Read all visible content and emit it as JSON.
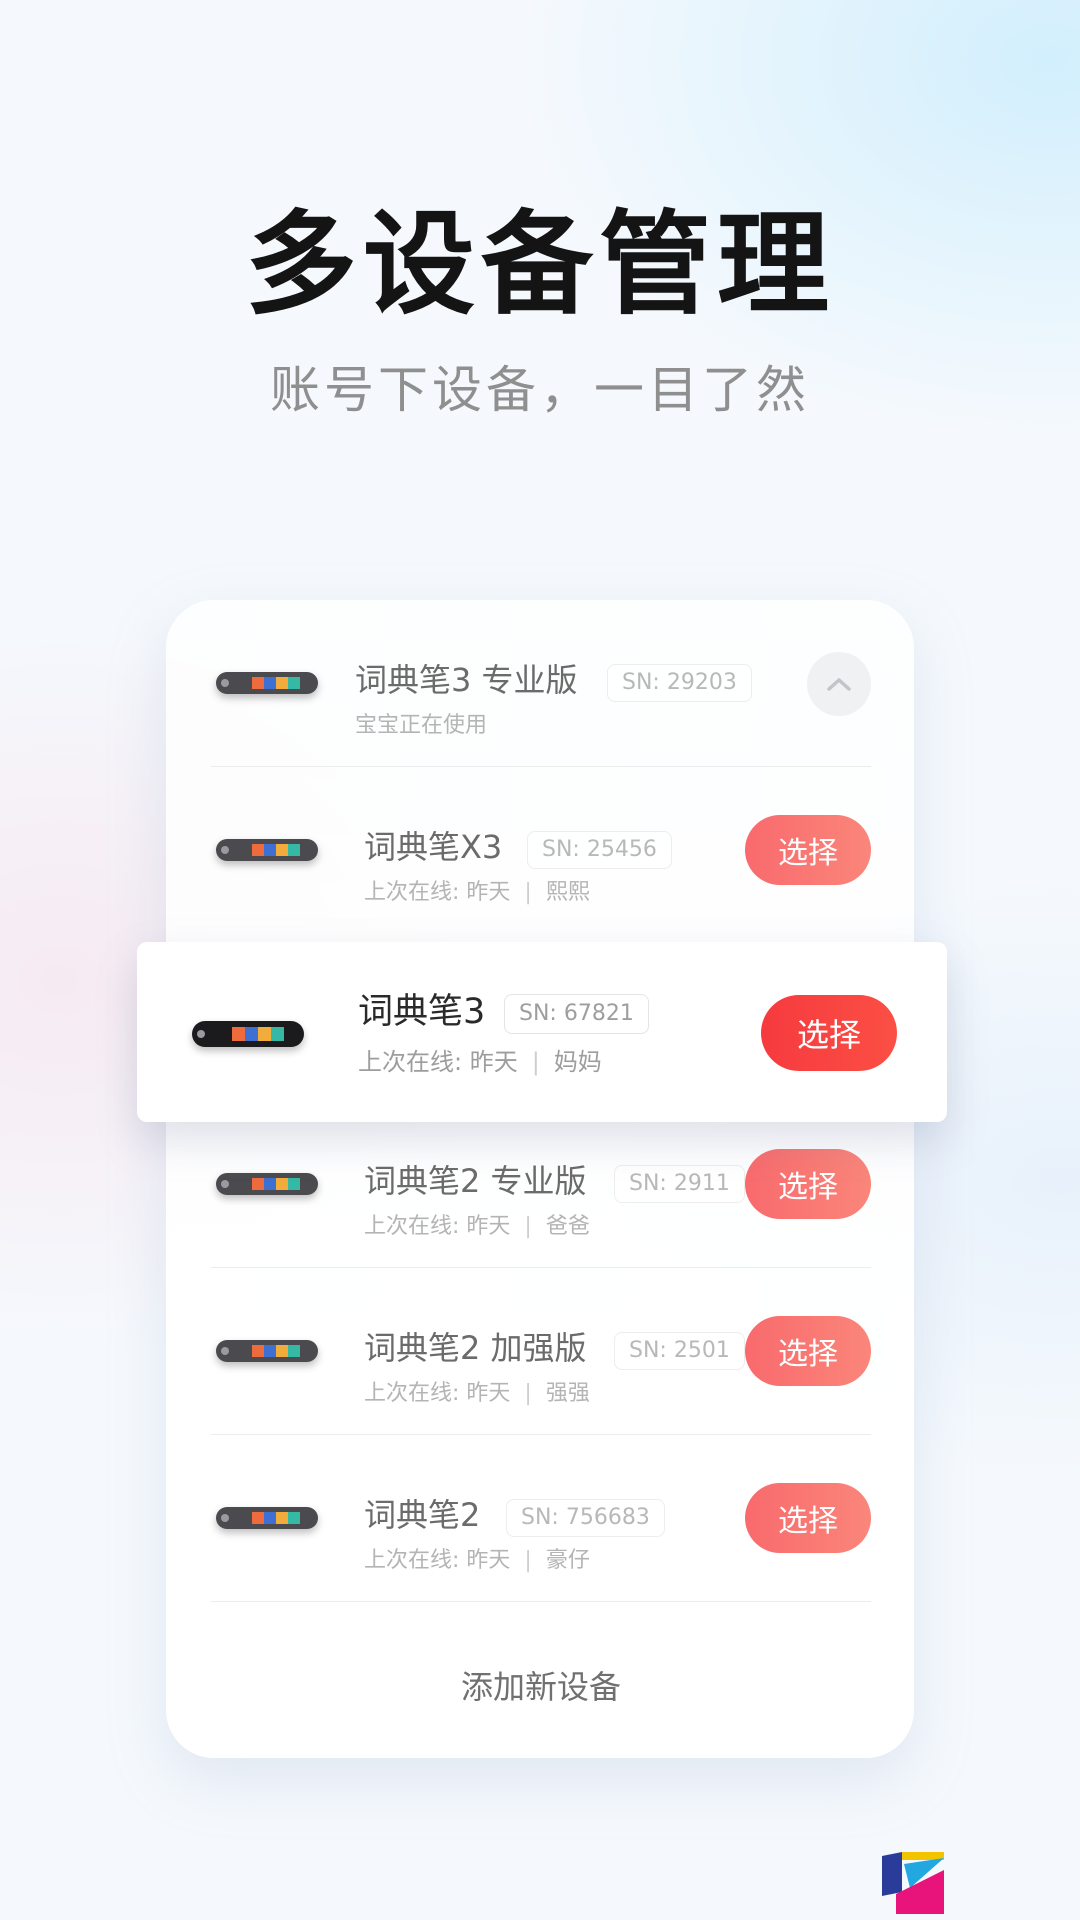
{
  "hero": {
    "title": "多设备管理",
    "subtitle": "账号下设备，一目了然"
  },
  "devices": [
    {
      "name": "词典笔3 专业版",
      "sn": "SN: 29203",
      "status": "宝宝正在使用",
      "action": "collapse",
      "action_icon": "chevron-up-icon"
    },
    {
      "name": "词典笔X3",
      "sn": "SN: 25456",
      "status_prefix": "上次在线: 昨天",
      "separator": "|",
      "user": "熙熙",
      "button": "选择"
    },
    {
      "name": "词典笔3",
      "sn": "SN: 67821",
      "status_prefix": "上次在线: 昨天",
      "separator": "|",
      "user": "妈妈",
      "button": "选择",
      "highlighted": true
    },
    {
      "name": "词典笔2 专业版",
      "sn": "SN: 2911",
      "status_prefix": "上次在线: 昨天",
      "separator": "|",
      "user": "爸爸",
      "button": "选择"
    },
    {
      "name": "词典笔2 加强版",
      "sn": "SN: 2501",
      "status_prefix": "上次在线: 昨天",
      "separator": "|",
      "user": "强强",
      "button": "选择"
    },
    {
      "name": "词典笔2",
      "sn": "SN: 756683",
      "status_prefix": "上次在线: 昨天",
      "separator": "|",
      "user": "豪仔",
      "button": "选择"
    }
  ],
  "add_device": "添加新设备",
  "colors": {
    "accent": "#f63a3f",
    "button_soft": "#f96a6d",
    "title": "#141414",
    "subtitle": "#8f8f8f"
  },
  "brand_logo": "app-logo-icon"
}
